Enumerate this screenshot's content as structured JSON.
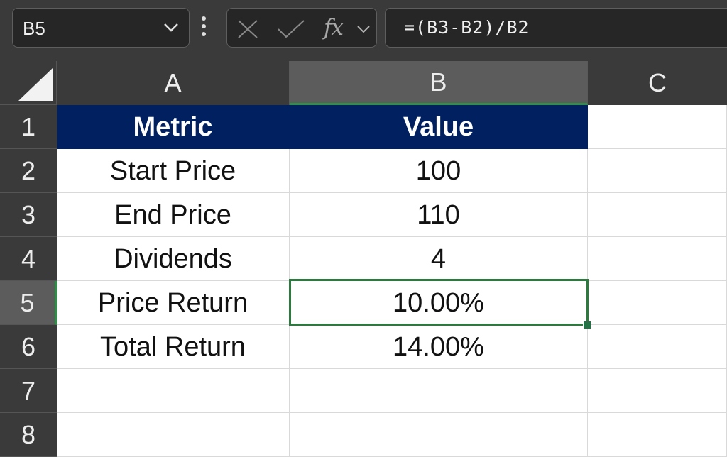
{
  "formula_bar": {
    "name_box": "B5",
    "formula": "=(B3-B2)/B2",
    "icons": [
      "chevron-down-icon",
      "more-vertical-icon",
      "cancel-x-icon",
      "enter-check-icon",
      "fx-icon"
    ]
  },
  "columns": [
    {
      "label": ""
    },
    {
      "label": "A"
    },
    {
      "label": "B"
    },
    {
      "label": "C"
    }
  ],
  "rows": [
    "1",
    "2",
    "3",
    "4",
    "5",
    "6",
    "7",
    "8"
  ],
  "cells": {
    "r1": {
      "a": "Metric",
      "b": "Value"
    },
    "r2": {
      "a": "Start Price",
      "b": "100"
    },
    "r3": {
      "a": "End Price",
      "b": "110"
    },
    "r4": {
      "a": "Dividends",
      "b": "4"
    },
    "r5": {
      "a": "Price Return",
      "b": "10.00%"
    },
    "r6": {
      "a": "Total Return",
      "b": "14.00%"
    },
    "r7": {
      "a": "",
      "b": ""
    },
    "r8": {
      "a": "",
      "b": ""
    }
  },
  "selection": {
    "active_cell": "B5"
  },
  "colors": {
    "header_fill": "#002060",
    "selection_green": "#2b7a3e",
    "toolbar_bg": "#3a3a3a"
  }
}
